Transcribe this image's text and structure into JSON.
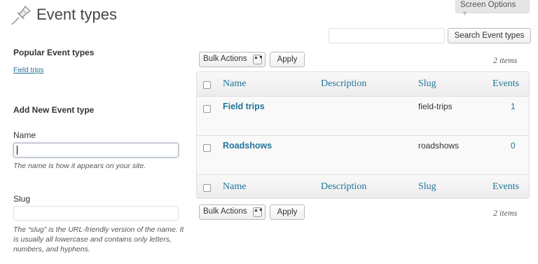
{
  "header": {
    "title": "Event types",
    "screen_options": "Screen Options",
    "screen_options_caret": "▼"
  },
  "search": {
    "value": "",
    "button": "Search Event types"
  },
  "sidebar": {
    "popular_heading": "Popular Event types",
    "popular_link": "Field trips",
    "add_heading": "Add New Event type",
    "name_label": "Name",
    "name_value": "",
    "name_help": "The name is how it appears on your site.",
    "slug_label": "Slug",
    "slug_value": "",
    "slug_help": "The “slug” is the URL-friendly version of the name. It is usually all lowercase and contains only letters, numbers, and hyphens."
  },
  "bulk": {
    "selected": "Bulk Actions",
    "arrows": "▲▼",
    "apply": "Apply",
    "count": "2 items"
  },
  "table": {
    "columns": [
      "Name",
      "Description",
      "Slug",
      "Events"
    ],
    "rows": [
      {
        "name": "Field trips",
        "slug": "field-trips",
        "events": "1"
      },
      {
        "name": "Roadshows",
        "slug": "roadshows",
        "events": "0"
      }
    ]
  },
  "colors": {
    "link": "#21759b",
    "text": "#333333",
    "border": "#dfdfdf"
  },
  "icons": {
    "title_icon": "pushpin-icon"
  }
}
